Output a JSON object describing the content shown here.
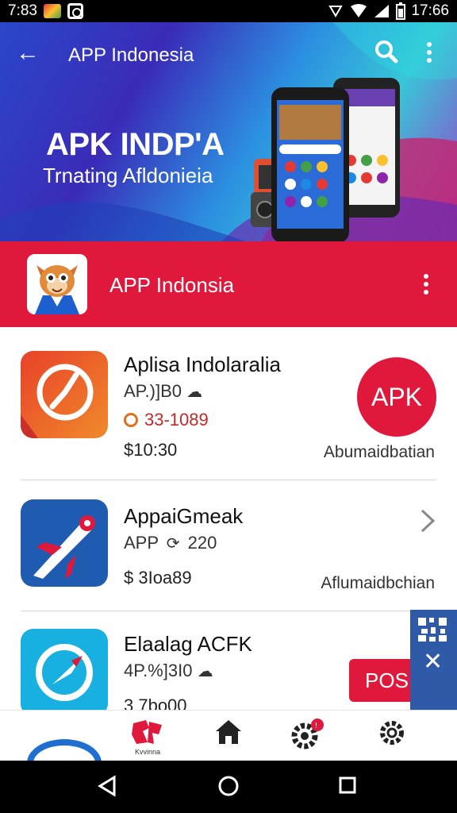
{
  "status_bar": {
    "time_left": "7:83",
    "time_right": "17:66"
  },
  "app_bar": {
    "title": "APP Indonesia"
  },
  "hero": {
    "title": "APK INDP'A",
    "subtitle": "Trnating Afldonieia"
  },
  "banner": {
    "title": "APP Indonsia"
  },
  "apps": [
    {
      "name": "Aplisa Indolaralia",
      "meta": "AP.)]B0",
      "rating": "33-1089",
      "price": "$10:30",
      "right_caption": "Abumaidbatian",
      "badge": "APK"
    },
    {
      "name": "AppaiGmeak",
      "meta": "APP",
      "meta2": "220",
      "price": "$ 3Ioa89",
      "right_caption": "Aflumaidbchian"
    },
    {
      "name": "Elaalag ACFK",
      "meta": "4P.%]3I0",
      "price": "3 7bo00",
      "button_label": "POS"
    }
  ],
  "bottom_nav": {
    "first_label": "Kvvinna"
  },
  "colors": {
    "accent_red": "#e0193c",
    "blue": "#2e5aa8"
  }
}
